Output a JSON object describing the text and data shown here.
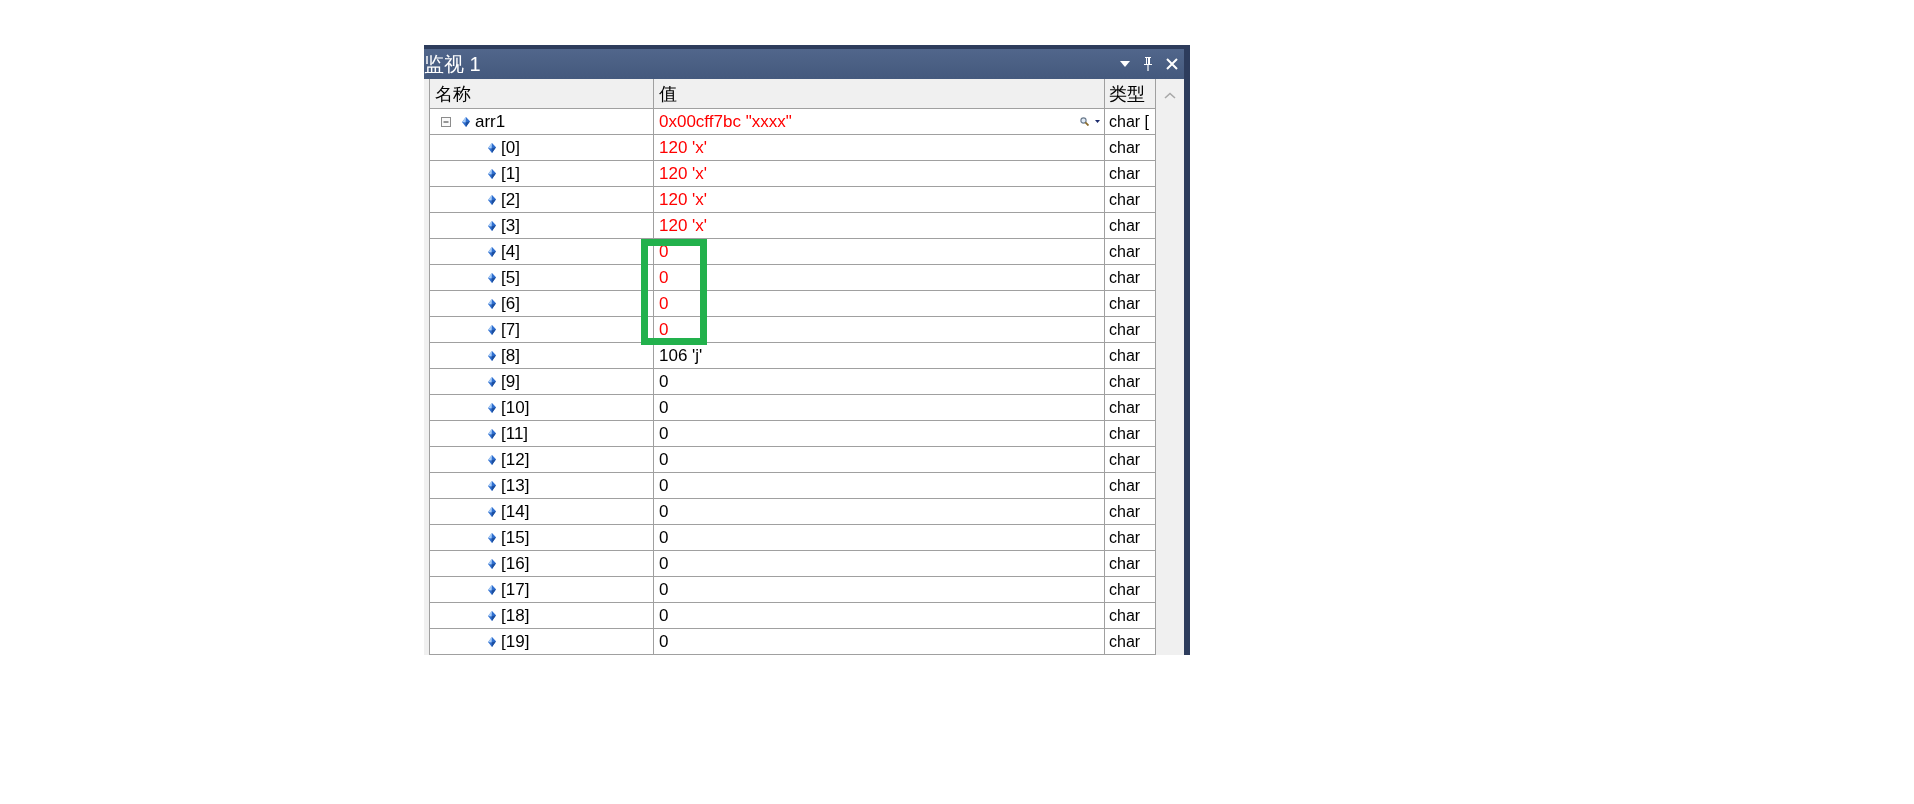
{
  "window": {
    "title": "监视 1"
  },
  "table": {
    "columns": [
      "名称",
      "值",
      "类型"
    ],
    "rows": [
      {
        "name": "arr1",
        "value": "0x00cff7bc \"xxxx\"",
        "type": "char [",
        "changed": true,
        "highlighted": false,
        "visualizer": true,
        "expanded": true,
        "children": [
          {
            "name": "[0]",
            "value": "120 'x'",
            "type": "char",
            "changed": true,
            "highlighted": false,
            "visualizer": false
          },
          {
            "name": "[1]",
            "value": "120 'x'",
            "type": "char",
            "changed": true,
            "highlighted": false,
            "visualizer": false
          },
          {
            "name": "[2]",
            "value": "120 'x'",
            "type": "char",
            "changed": true,
            "highlighted": false,
            "visualizer": false
          },
          {
            "name": "[3]",
            "value": "120 'x'",
            "type": "char",
            "changed": true,
            "highlighted": false,
            "visualizer": false
          },
          {
            "name": "[4]",
            "value": "0",
            "type": "char",
            "changed": true,
            "highlighted": true,
            "visualizer": false
          },
          {
            "name": "[5]",
            "value": "0",
            "type": "char",
            "changed": true,
            "highlighted": true,
            "visualizer": false
          },
          {
            "name": "[6]",
            "value": "0",
            "type": "char",
            "changed": true,
            "highlighted": true,
            "visualizer": false
          },
          {
            "name": "[7]",
            "value": "0",
            "type": "char",
            "changed": true,
            "highlighted": true,
            "visualizer": false
          },
          {
            "name": "[8]",
            "value": "106 'j'",
            "type": "char",
            "changed": false,
            "highlighted": false,
            "visualizer": false
          },
          {
            "name": "[9]",
            "value": "0",
            "type": "char",
            "changed": false,
            "highlighted": false,
            "visualizer": false
          },
          {
            "name": "[10]",
            "value": "0",
            "type": "char",
            "changed": false,
            "highlighted": false,
            "visualizer": false
          },
          {
            "name": "[11]",
            "value": "0",
            "type": "char",
            "changed": false,
            "highlighted": false,
            "visualizer": false
          },
          {
            "name": "[12]",
            "value": "0",
            "type": "char",
            "changed": false,
            "highlighted": false,
            "visualizer": false
          },
          {
            "name": "[13]",
            "value": "0",
            "type": "char",
            "changed": false,
            "highlighted": false,
            "visualizer": false
          },
          {
            "name": "[14]",
            "value": "0",
            "type": "char",
            "changed": false,
            "highlighted": false,
            "visualizer": false
          },
          {
            "name": "[15]",
            "value": "0",
            "type": "char",
            "changed": false,
            "highlighted": false,
            "visualizer": false
          },
          {
            "name": "[16]",
            "value": "0",
            "type": "char",
            "changed": false,
            "highlighted": false,
            "visualizer": false
          },
          {
            "name": "[17]",
            "value": "0",
            "type": "char",
            "changed": false,
            "highlighted": false,
            "visualizer": false
          },
          {
            "name": "[18]",
            "value": "0",
            "type": "char",
            "changed": false,
            "highlighted": false,
            "visualizer": false
          },
          {
            "name": "[19]",
            "value": "0",
            "type": "char",
            "changed": false,
            "highlighted": false,
            "visualizer": false
          }
        ]
      }
    ]
  }
}
